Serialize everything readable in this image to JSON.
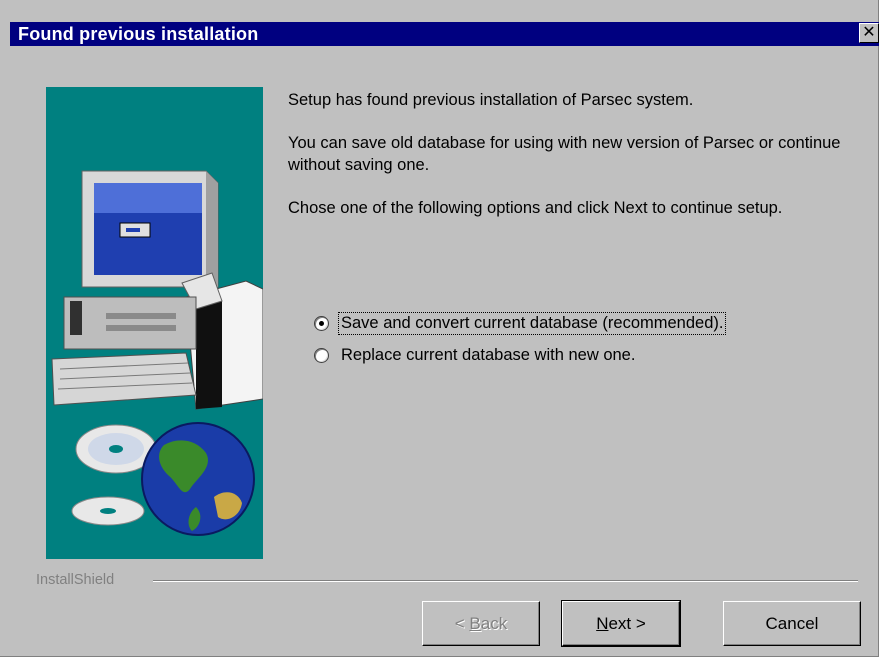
{
  "window": {
    "title": "Found previous installation",
    "close_glyph": "✕"
  },
  "body": {
    "paragraphs": [
      "Setup has found previous installation of Parsec system.",
      "You can save old database for using with new version of Parsec or continue without saving one.",
      "Chose one of the following options and click Next to continue setup."
    ]
  },
  "options": [
    {
      "label": "Save and convert current database (recommended).",
      "selected": true
    },
    {
      "label": "Replace current database with new one.",
      "selected": false
    }
  ],
  "footer": {
    "brand": "InstallShield"
  },
  "buttons": {
    "back": {
      "prefix": "< ",
      "mnemonic": "B",
      "rest": "ack",
      "enabled": false
    },
    "next": {
      "mnemonic": "N",
      "rest": "ext >",
      "enabled": true
    },
    "cancel": {
      "label": "Cancel",
      "enabled": true
    }
  },
  "colors": {
    "titlebar": "#000080",
    "panel": "#008080",
    "face": "#c0c0c0"
  },
  "icons": [
    "computer-illustration",
    "cd-disc-icon",
    "globe-icon",
    "close-icon"
  ]
}
